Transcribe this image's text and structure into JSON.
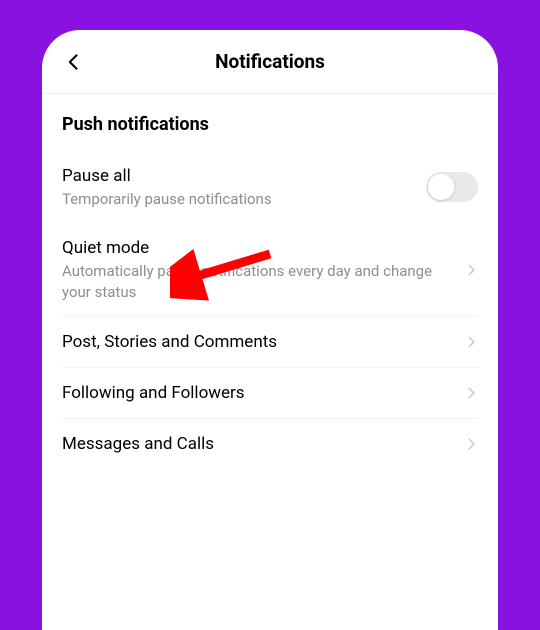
{
  "header": {
    "title": "Notifications"
  },
  "section": {
    "title": "Push notifications"
  },
  "rows": {
    "pauseAll": {
      "label": "Pause all",
      "sub": "Temporarily pause notifications"
    },
    "quietMode": {
      "label": "Quiet mode",
      "sub": "Automatically pause notifications every day and change your status"
    },
    "posts": {
      "label": "Post, Stories and Comments"
    },
    "following": {
      "label": "Following and Followers"
    },
    "messages": {
      "label": "Messages and Calls"
    }
  },
  "annotation": {
    "color": "#ff0000"
  }
}
